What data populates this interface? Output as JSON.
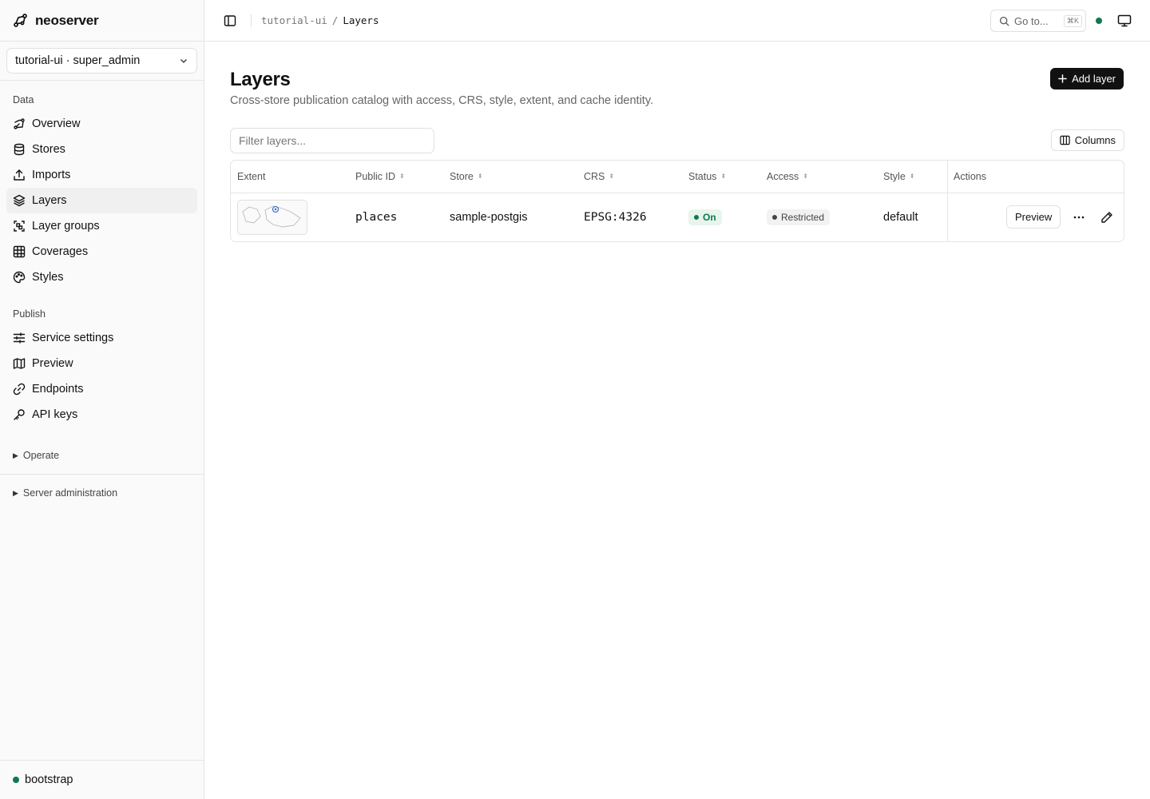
{
  "app": {
    "name": "neoserver"
  },
  "project_selector": {
    "label": "tutorial-ui · super_admin"
  },
  "sidebar": {
    "sections": [
      {
        "label": "Data",
        "items": [
          {
            "label": "Overview",
            "icon": "overview-icon"
          },
          {
            "label": "Stores",
            "icon": "database-icon"
          },
          {
            "label": "Imports",
            "icon": "upload-icon"
          },
          {
            "label": "Layers",
            "icon": "layers-icon",
            "active": true
          },
          {
            "label": "Layer groups",
            "icon": "group-icon"
          },
          {
            "label": "Coverages",
            "icon": "grid-icon"
          },
          {
            "label": "Styles",
            "icon": "palette-icon"
          }
        ]
      },
      {
        "label": "Publish",
        "items": [
          {
            "label": "Service settings",
            "icon": "sliders-icon"
          },
          {
            "label": "Preview",
            "icon": "map-icon"
          },
          {
            "label": "Endpoints",
            "icon": "link-icon"
          },
          {
            "label": "API keys",
            "icon": "key-icon"
          }
        ]
      }
    ],
    "collapsibles": [
      {
        "label": "Operate"
      },
      {
        "label": "Server administration"
      }
    ],
    "footer_status": "bootstrap"
  },
  "topbar": {
    "breadcrumb": {
      "parent": "tutorial-ui",
      "separator": "/",
      "current": "Layers"
    },
    "goto": {
      "label": "Go to...",
      "shortcut": "⌘K"
    },
    "status_color": "#0e7a4d"
  },
  "page": {
    "title": "Layers",
    "subtitle": "Cross-store publication catalog with access, CRS, style, extent, and cache identity.",
    "add_button": "Add layer",
    "filter_placeholder": "Filter layers...",
    "columns_button": "Columns"
  },
  "table": {
    "headers": {
      "extent": "Extent",
      "public_id": "Public ID",
      "store": "Store",
      "crs": "CRS",
      "status": "Status",
      "access": "Access",
      "style": "Style",
      "actions": "Actions"
    },
    "rows": [
      {
        "public_id": "places",
        "store": "sample-postgis",
        "crs": "EPSG:4326",
        "status": "On",
        "access": "Restricted",
        "style": "default",
        "preview_button": "Preview"
      }
    ]
  },
  "colors": {
    "accent": "#111111",
    "success": "#0e7a4d",
    "border": "#e5e5e5"
  }
}
